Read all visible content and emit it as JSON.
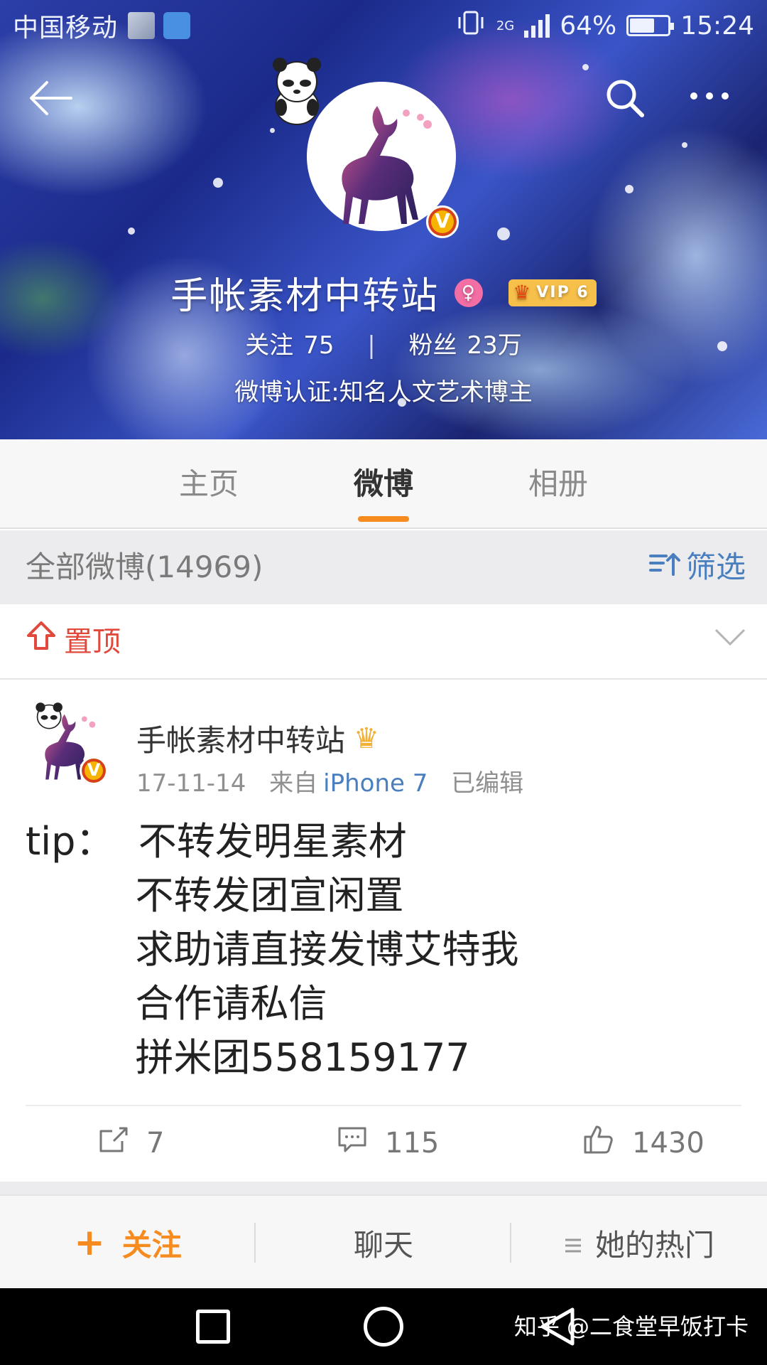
{
  "status_bar": {
    "carrier": "中国移动",
    "network": "2G",
    "battery": "64%",
    "battery_level": 0.64,
    "time": "15:24"
  },
  "profile": {
    "name": "手帐素材中转站",
    "vip_label": "VIP 6",
    "following_label": "关注",
    "following_count": "75",
    "fans_label": "粉丝",
    "fans_count": "23万",
    "verification": "微博认证:知名人文艺术博主"
  },
  "tabs": [
    {
      "label": "主页",
      "active": false
    },
    {
      "label": "微博",
      "active": true
    },
    {
      "label": "相册",
      "active": false
    }
  ],
  "filter": {
    "title": "全部微博(14969)",
    "button_label": "筛选"
  },
  "pinned": {
    "label": "置顶"
  },
  "post": {
    "author": "手帐素材中转站",
    "date": "17-11-14",
    "source_prefix": "来自",
    "source": "iPhone 7",
    "edited": "已编辑",
    "lines": [
      "tip：  不转发明星素材",
      "         不转发团宣闲置",
      "         求助请直接发博艾特我",
      "         合作请私信",
      "         拼米团558159177"
    ],
    "reposts": "7",
    "comments": "115",
    "likes": "1430"
  },
  "bottom_bar": {
    "follow_label": "关注",
    "chat_label": "聊天",
    "hot_label": "她的热门"
  },
  "watermark": "知乎 @二食堂早饭打卡",
  "colors": {
    "accent_orange": "#f68b1f",
    "link_blue": "#4a7fbf",
    "pinned_red": "#e0493c"
  }
}
